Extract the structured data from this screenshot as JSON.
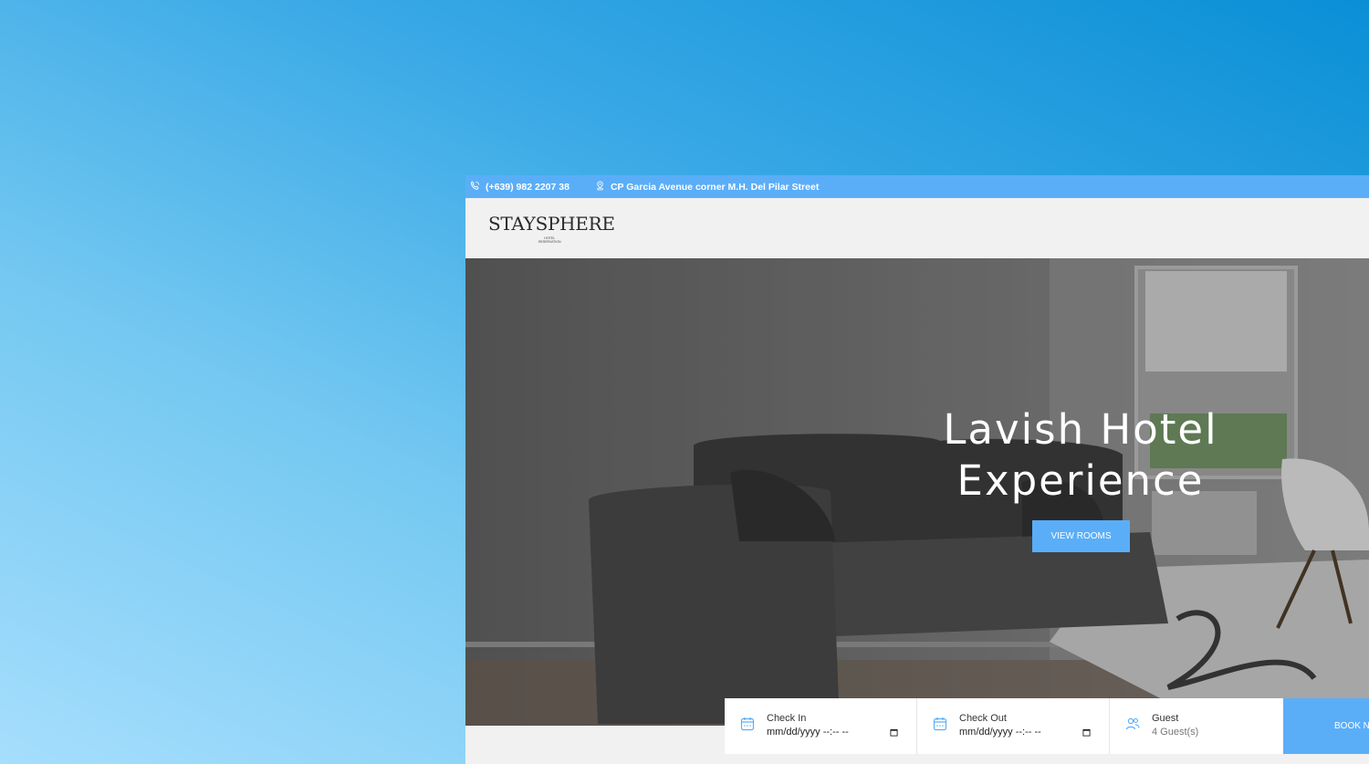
{
  "topbar": {
    "phone": "(+639) 982 2207 38",
    "address": "CP Garcia Avenue corner M.H. Del Pilar Street"
  },
  "brand": {
    "logo_text": "STAYSPHERE",
    "logo_sub_1": "HOTEL",
    "logo_sub_2": "RESERVATION"
  },
  "hero": {
    "title_line1": "Lavish Hotel",
    "title_line2": "Experience",
    "button_label": "VIEW ROOMS"
  },
  "booking": {
    "check_in_label": "Check In",
    "check_in_value": "mm/dd/yyyy --:-- --",
    "check_out_label": "Check Out",
    "check_out_value": "mm/dd/yyyy --:-- --",
    "guest_label": "Guest",
    "guest_value": "4 Guest(s)",
    "book_button": "BOOK N"
  },
  "colors": {
    "accent": "#5aaef8",
    "bg_gradient_start": "#0a8fd6",
    "bg_gradient_end": "#a6defd"
  }
}
